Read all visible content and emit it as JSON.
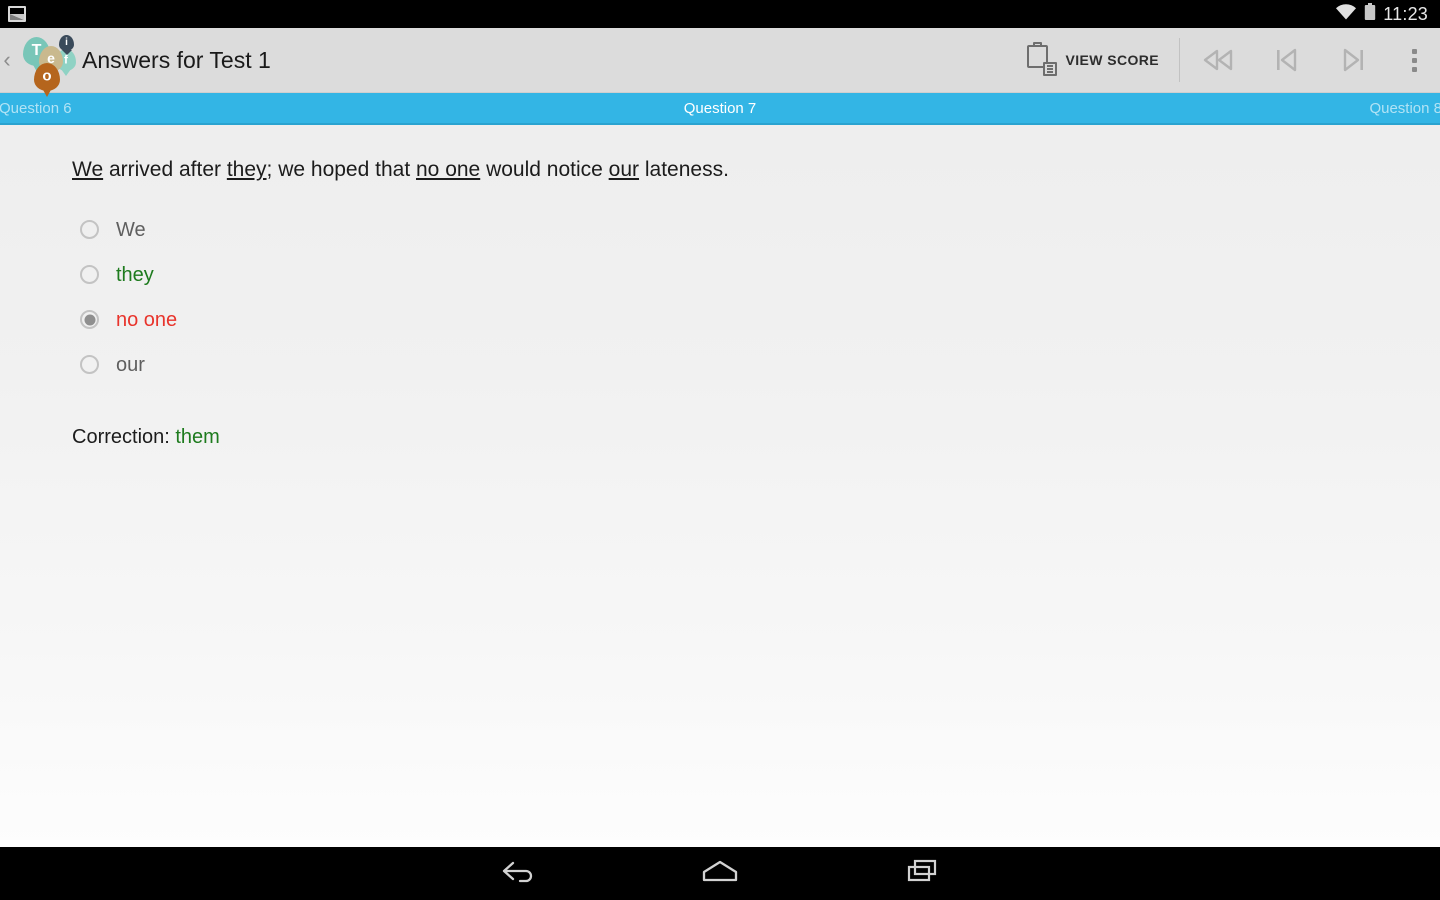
{
  "status_bar": {
    "notification_icon": "screenshot-icon",
    "wifi_icon": "wifi-icon",
    "battery_icon": "battery-icon",
    "clock": "11:23"
  },
  "toolbar": {
    "up_chevron": "‹",
    "logo_letters": [
      "T",
      "e",
      "o",
      "i",
      "f"
    ],
    "logo_alt": "teofi-balloons-logo",
    "title": "Answers for Test 1",
    "view_score_label": "VIEW SCORE",
    "view_score_icon": "clipboard-list-icon",
    "rewind_icon": "rewind-icon",
    "skip_previous_icon": "skip-previous-icon",
    "skip_next_icon": "skip-next-icon",
    "overflow_icon": "overflow-menu-icon",
    "background_color": "#dcdcdc"
  },
  "tabs": {
    "previous": "Question 6",
    "current": "Question 7",
    "next": "Question 8",
    "accent_color": "#33b5e5"
  },
  "question": {
    "segments": [
      {
        "text": "We",
        "underline": true
      },
      {
        "text": " arrived after ",
        "underline": false
      },
      {
        "text": "they",
        "underline": true
      },
      {
        "text": "; we hoped that ",
        "underline": false
      },
      {
        "text": "no one",
        "underline": true
      },
      {
        "text": " would notice ",
        "underline": false
      },
      {
        "text": "our",
        "underline": true
      },
      {
        "text": " lateness.",
        "underline": false
      }
    ],
    "full_text": "We arrived after they; we hoped that no one would notice our lateness."
  },
  "options": [
    {
      "label": "We",
      "state": "neutral",
      "selected": false
    },
    {
      "label": "they",
      "state": "correct",
      "selected": false
    },
    {
      "label": "no one",
      "state": "wrong",
      "selected": true
    },
    {
      "label": "our",
      "state": "neutral",
      "selected": false
    }
  ],
  "correction": {
    "prefix": "Correction: ",
    "value": "them"
  },
  "colors": {
    "correct_green": "#1e7b1e",
    "wrong_red": "#e8342c",
    "neutral_gray": "#5f5f5f",
    "accent_blue": "#33b5e5"
  },
  "nav_bar": {
    "back_icon": "back-arrow-icon",
    "home_icon": "home-icon",
    "recents_icon": "recent-apps-icon"
  }
}
